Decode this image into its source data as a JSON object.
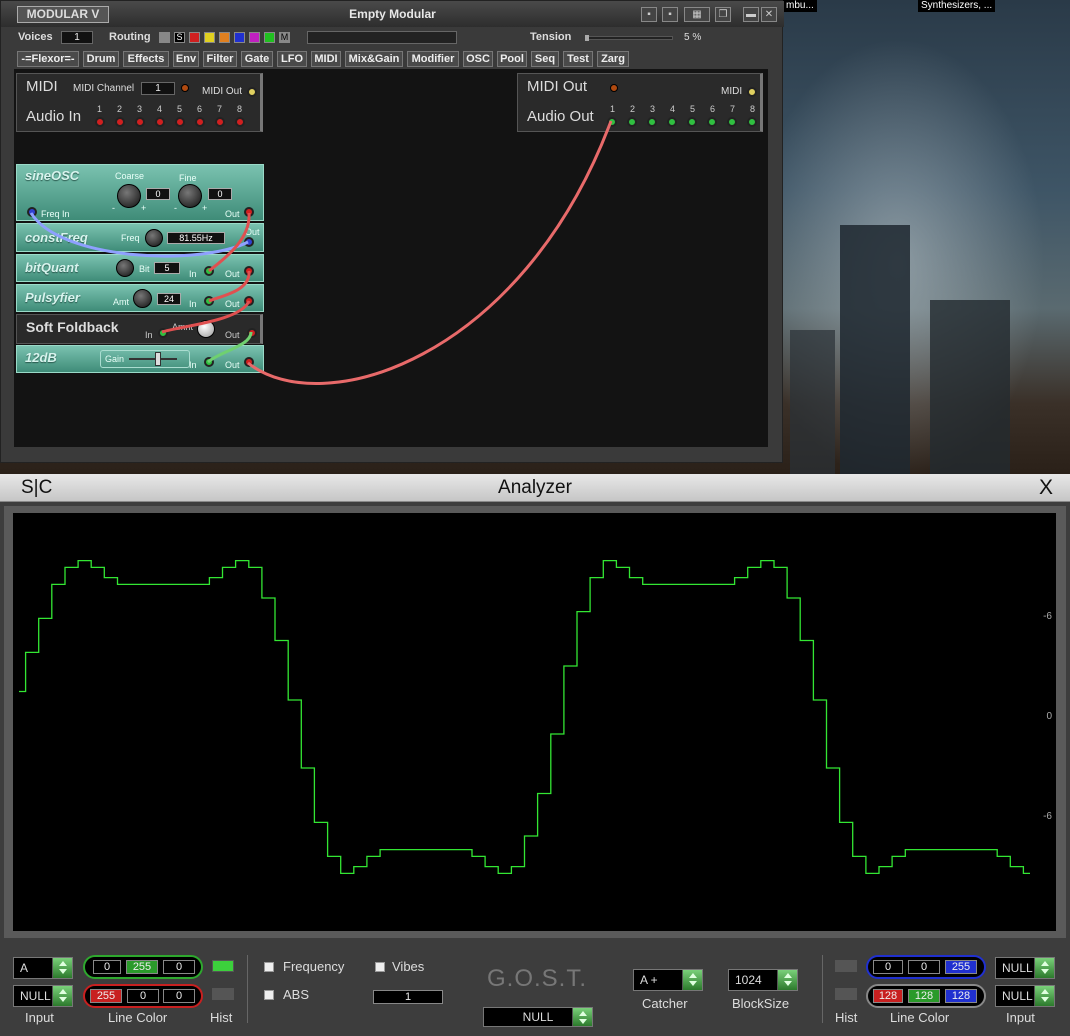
{
  "taskbar": [
    "mbu...",
    "Synthesizers, ..."
  ],
  "modular": {
    "logo": "MODULAR V",
    "title": "Empty Modular",
    "voices_label": "Voices",
    "voices_value": "1",
    "routing_label": "Routing",
    "routing_s": "S",
    "routing_m": "M",
    "tension_label": "Tension",
    "tension_value": "5 %",
    "categories": [
      "-=Flexor=-",
      "Drum",
      "Effects",
      "Env",
      "Filter",
      "Gate",
      "LFO",
      "MIDI",
      "Mix&Gain",
      "Modifier",
      "OSC",
      "Pool",
      "Seq",
      "Test",
      "Zarg"
    ],
    "midi_in": {
      "midi_label": "MIDI",
      "channel_label": "MIDI Channel",
      "channel_value": "1",
      "midi_out_label": "MIDI Out",
      "audio_in_label": "Audio In",
      "ports": [
        "1",
        "2",
        "3",
        "4",
        "5",
        "6",
        "7",
        "8"
      ]
    },
    "midi_out": {
      "midi_out_label": "MIDI Out",
      "midi_label": "MIDI",
      "audio_out_label": "Audio Out",
      "ports": [
        "1",
        "2",
        "3",
        "4",
        "5",
        "6",
        "7",
        "8"
      ]
    },
    "modules": {
      "sineosc": {
        "title": "sineOSC",
        "coarse": "Coarse",
        "fine": "Fine",
        "coarse_value": "0",
        "fine_value": "0",
        "freq_in": "Freq In",
        "out": "Out",
        "minus": "-",
        "plus": "+"
      },
      "constfreq": {
        "title": "constFreq",
        "freq": "Freq",
        "freq_value": "81.55Hz",
        "out": "Out"
      },
      "bitquant": {
        "title": "bitQuant",
        "bit": "Bit",
        "bit_value": "5",
        "in": "In",
        "out": "Out"
      },
      "pulsyfier": {
        "title": "Pulsyfier",
        "amt": "Amt",
        "amt_value": "24",
        "in": "In",
        "out": "Out"
      },
      "softfoldback": {
        "title": "Soft Foldback",
        "amnt": "Amnt",
        "in": "In",
        "out": "Out"
      },
      "db12": {
        "title": "12dB",
        "gain": "Gain",
        "in": "In",
        "out": "Out"
      }
    }
  },
  "analyzer": {
    "sc": "S|C",
    "title": "Analyzer",
    "close": "X",
    "y_labels": [
      "-6",
      "0",
      "-6"
    ],
    "trace_color": "#33e633",
    "waveform_samples": [
      0.15,
      0.38,
      0.58,
      0.78,
      0.88,
      0.92,
      0.88,
      0.82,
      0.78,
      0.78,
      0.78,
      0.78,
      0.78,
      0.78,
      0.78,
      0.82,
      0.88,
      0.92,
      0.88,
      0.7,
      0.45,
      0.1,
      -0.3,
      -0.62,
      -0.82,
      -0.92,
      -0.88,
      -0.82,
      -0.78,
      -0.78,
      -0.78,
      -0.78,
      -0.78,
      -0.78,
      -0.78,
      -0.82,
      -0.88,
      -0.92,
      -0.88,
      -0.7,
      -0.45,
      -0.1,
      0.3,
      0.62,
      0.82,
      0.92,
      0.88,
      0.82,
      0.78,
      0.78,
      0.78,
      0.78,
      0.78,
      0.78,
      0.78,
      0.82,
      0.88,
      0.92,
      0.88,
      0.7,
      0.45,
      0.1,
      -0.3,
      -0.62,
      -0.82,
      -0.92,
      -0.88,
      -0.82,
      -0.78,
      -0.78,
      -0.78,
      -0.78,
      -0.78,
      -0.78,
      -0.78,
      -0.82,
      -0.88,
      -0.92
    ],
    "left_input_top": "A",
    "left_input_bottom": "NULL",
    "input_label": "Input",
    "line_color_label": "Line Color",
    "hist_label": "Hist",
    "lc_top": [
      "0",
      "255",
      "0"
    ],
    "lc_bottom": [
      "255",
      "0",
      "0"
    ],
    "frequency_label": "Frequency",
    "abs_label": "ABS",
    "vibes_label": "Vibes",
    "vibes_value": "1",
    "gost": "G.O.S.T.",
    "gost_select": "NULL",
    "catcher_label": "Catcher",
    "catcher_value": "A +",
    "blocksize_label": "BlockSize",
    "blocksize_value": "1024",
    "rc_top": [
      "0",
      "0",
      "255"
    ],
    "rc_bottom": [
      "128",
      "128",
      "128"
    ],
    "right_input_top": "NULL",
    "right_input_bottom": "NULL"
  }
}
